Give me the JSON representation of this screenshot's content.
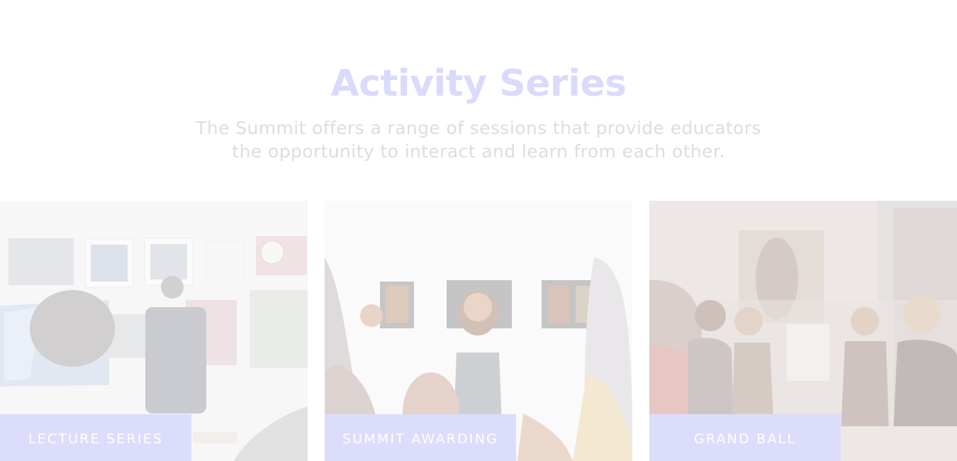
{
  "section": {
    "title": "Activity Series",
    "description_line1": "The Summit offers a range of sessions that provide educators",
    "description_line2": "the opportunity to interact and learn from each other."
  },
  "cards": [
    {
      "label": "LECTURE SERIES",
      "image_icon": "lecture-photo"
    },
    {
      "label": "SUMMIT AWARDING",
      "image_icon": "awarding-photo"
    },
    {
      "label": "GRAND BALL",
      "image_icon": "ball-photo"
    }
  ],
  "colors": {
    "title": "#dadbfb",
    "description": "#dcdde2",
    "label_box": "#dcddfb",
    "label_text": "#ffffff"
  }
}
